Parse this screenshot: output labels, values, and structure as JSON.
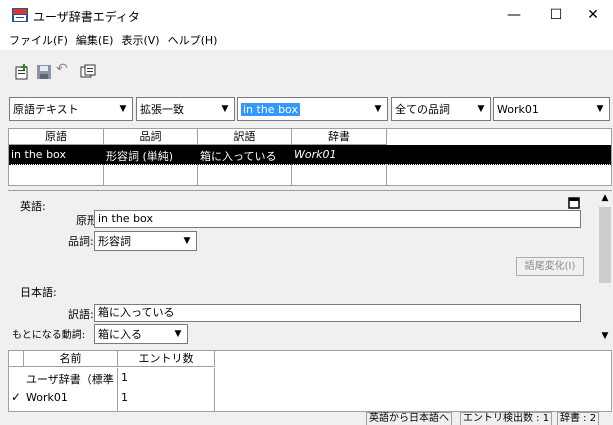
{
  "window": {
    "title": "ユーザ辞書エディタ",
    "minimize": "—",
    "maximize": "☐",
    "close": "✕"
  },
  "menu": [
    "ファイル(F)",
    "編集(E)",
    "表示(V)",
    "ヘルプ(H)"
  ],
  "toolbar": {
    "icons": [
      "new-entry-icon",
      "save-icon",
      "undo-icon",
      "dictionary-icon"
    ],
    "undo_glyph": "↶",
    "new_glyph": "✚"
  },
  "filters": {
    "field": "原語テキスト",
    "match": "拡張一致",
    "query": "in the box",
    "pos": "全ての品詞",
    "dictionary": "Work01"
  },
  "result_list": {
    "columns": [
      "原語",
      "品詞",
      "訳語",
      "辞書"
    ],
    "rows": [
      {
        "source": "in the box",
        "pos": "形容詞 (単純)",
        "translation": "箱に入っている",
        "dictionary": "Work01",
        "selected": true
      }
    ]
  },
  "detail": {
    "english_label": "英語:",
    "base_form_label": "原形",
    "base_form": "in the box",
    "pos_label": "品詞:",
    "pos": "形容詞",
    "inflection_button": "語尾変化(I)",
    "japanese_label": "日本語:",
    "translation_label": "訳語:",
    "translation": "箱に入っている",
    "base_verb_label": "もとになる動詞:",
    "base_verb": "箱に入る"
  },
  "dict_list": {
    "columns": [
      "名前",
      "エントリ数"
    ],
    "rows": [
      {
        "name": "ユーザ辞書（標準",
        "count": "1",
        "checked": false
      },
      {
        "name": "Work01",
        "count": "1",
        "checked": true
      }
    ]
  },
  "status": {
    "direction": "英語から日本語へ",
    "hits": "エントリ検出数 : 1",
    "dicts": "辞書 : 2"
  }
}
